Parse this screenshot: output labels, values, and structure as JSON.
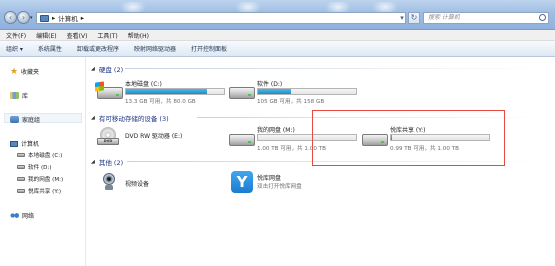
{
  "address": {
    "crumbs": [
      "计算机"
    ],
    "search_placeholder": "搜索 计算机"
  },
  "menu": [
    "文件(F)",
    "编辑(E)",
    "查看(V)",
    "工具(T)",
    "帮助(H)"
  ],
  "toolbar": [
    "组织 ▾",
    "系统属性",
    "卸载或更改程序",
    "映射网络驱动器",
    "打开控制面板"
  ],
  "sidebar": {
    "favorites": "收藏夹",
    "libraries": "库",
    "homegroup": "家庭组",
    "computer": "计算机",
    "drives": [
      "本地磁盘 (C:)",
      "软件 (D:)",
      "我的网盘 (M:)",
      "悦库共享 (Y:)"
    ],
    "network": "网络"
  },
  "groups": {
    "hdd": "硬盘 (2)",
    "removable": "有可移动存储的设备 (3)",
    "other": "其他 (2)"
  },
  "drives": {
    "c": {
      "name": "本地磁盘 (C:)",
      "free": "13.3 GB 可用，共 80.0 GB",
      "used_fraction": 0.83
    },
    "d": {
      "name": "软件 (D:)",
      "free": "105 GB 可用，共 158 GB",
      "used_fraction": 0.34
    },
    "dvd": {
      "name": "DVD RW 驱动器 (E:)"
    },
    "m": {
      "name": "我的网盘 (M:)",
      "free": "1.00 TB 可用，共 1.00 TB",
      "used_fraction": 0.0
    },
    "y": {
      "name": "悦库共享 (Y:)",
      "free": "0.99 TB 可用，共 1.00 TB",
      "used_fraction": 0.01
    }
  },
  "other_items": {
    "camera": {
      "name": "视频设备"
    },
    "app": {
      "name": "悦库网盘",
      "desc": "双击打开悦库网盘",
      "icon_char": "Y"
    }
  },
  "icons": {
    "accent": "#1a8ec9",
    "highlight": "#e64a40"
  }
}
